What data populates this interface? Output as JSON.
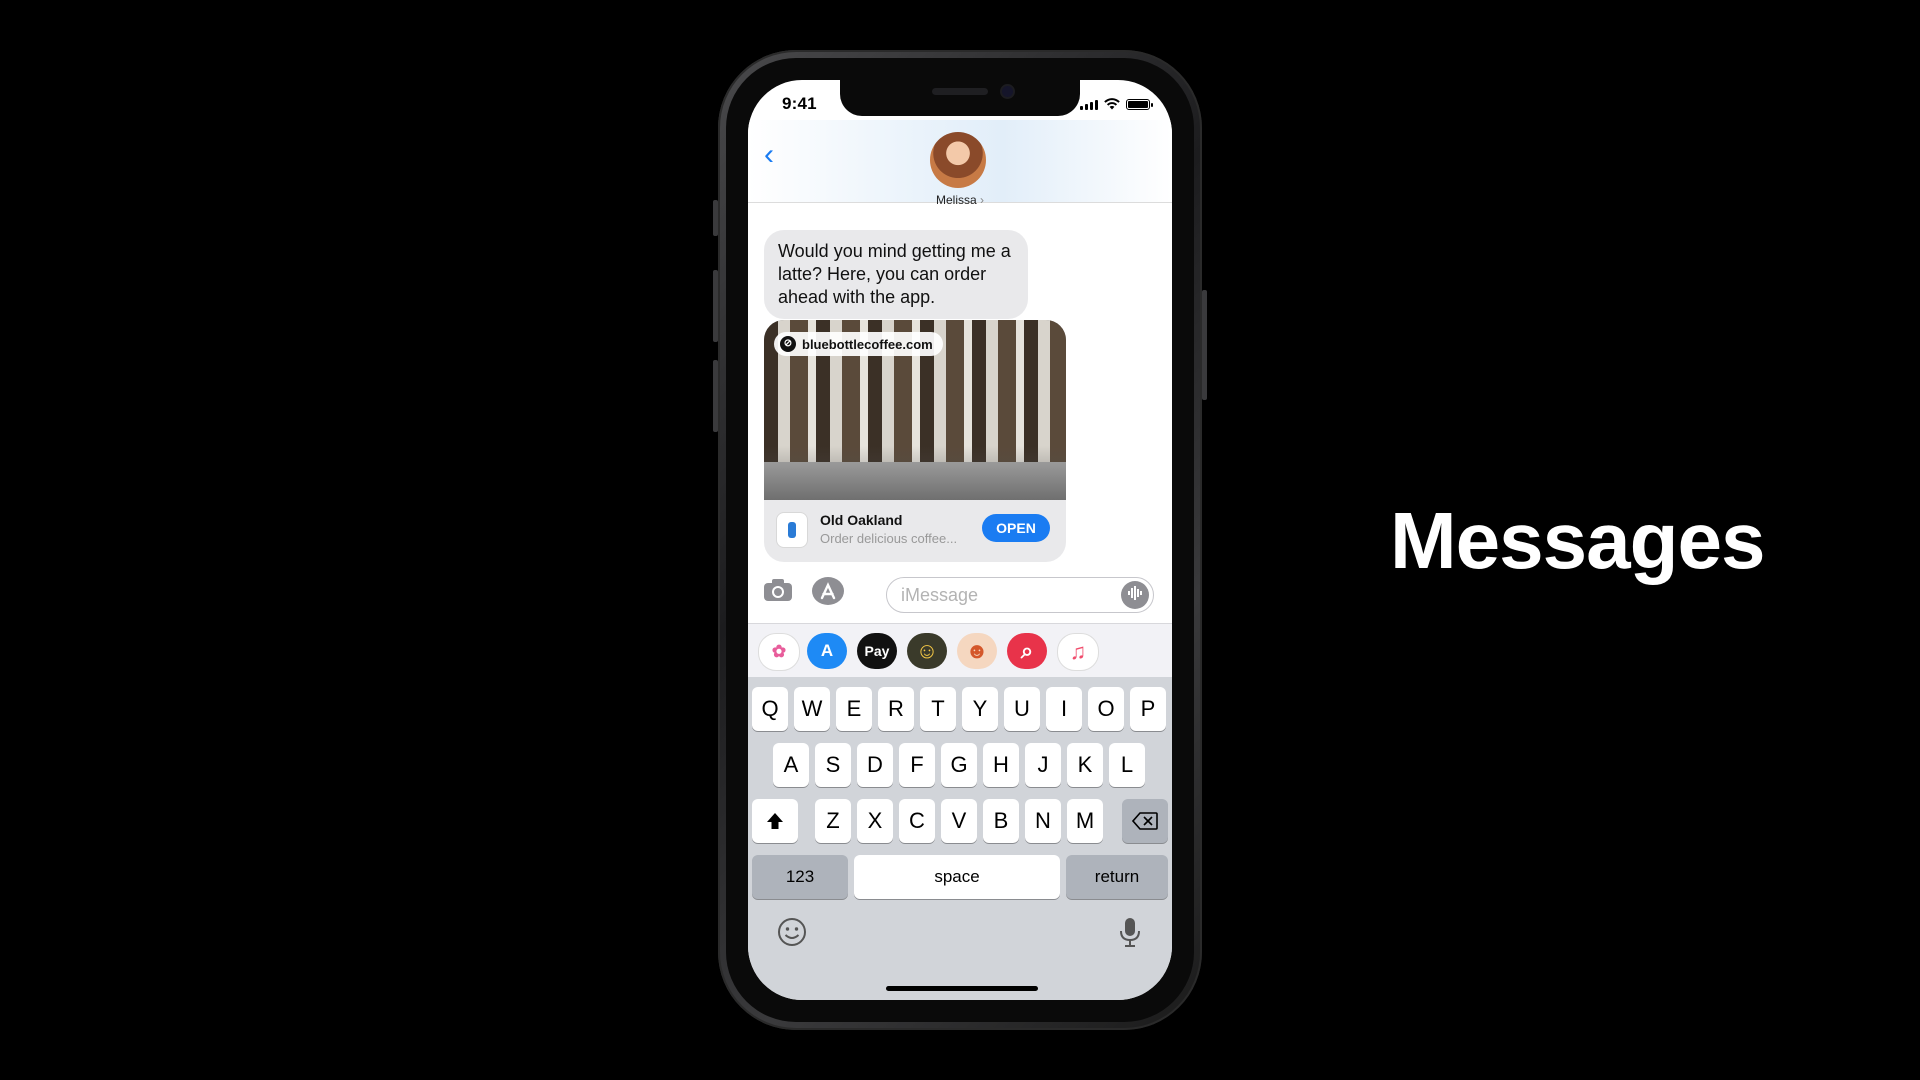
{
  "status_bar": {
    "time": "9:41"
  },
  "conversation": {
    "contact_name": "Melissa",
    "contact_chevron": "›",
    "back_icon": "‹"
  },
  "message": {
    "text": "Would you mind getting me a latte? Here, you can order ahead with the app."
  },
  "link_card": {
    "url": "bluebottlecoffee.com",
    "app_name": "Old Oakland",
    "app_subtitle": "Order delicious coffee...",
    "open_label": "OPEN"
  },
  "composer": {
    "placeholder": "iMessage"
  },
  "app_drawer": [
    {
      "name": "photos-app-icon",
      "glyph": "✿"
    },
    {
      "name": "app-store-icon",
      "glyph": "A"
    },
    {
      "name": "apple-pay-icon",
      "glyph": "Pay"
    },
    {
      "name": "memoji-icon",
      "glyph": "☺"
    },
    {
      "name": "memoji-sticker-icon",
      "glyph": "☻"
    },
    {
      "name": "images-search-icon",
      "glyph": "⌕"
    },
    {
      "name": "music-app-icon",
      "glyph": "♫"
    }
  ],
  "keyboard": {
    "row1": [
      "Q",
      "W",
      "E",
      "R",
      "T",
      "Y",
      "U",
      "I",
      "O",
      "P"
    ],
    "row2": [
      "A",
      "S",
      "D",
      "F",
      "G",
      "H",
      "J",
      "K",
      "L"
    ],
    "row3": [
      "Z",
      "X",
      "C",
      "V",
      "B",
      "N",
      "M"
    ],
    "numbers_label": "123",
    "space_label": "space",
    "return_label": "return"
  },
  "slide_title": "Messages",
  "colors": {
    "accent": "#1a7cf2",
    "bubble_gray": "#e9e9eb",
    "keyboard_bg": "#d1d4d9"
  }
}
